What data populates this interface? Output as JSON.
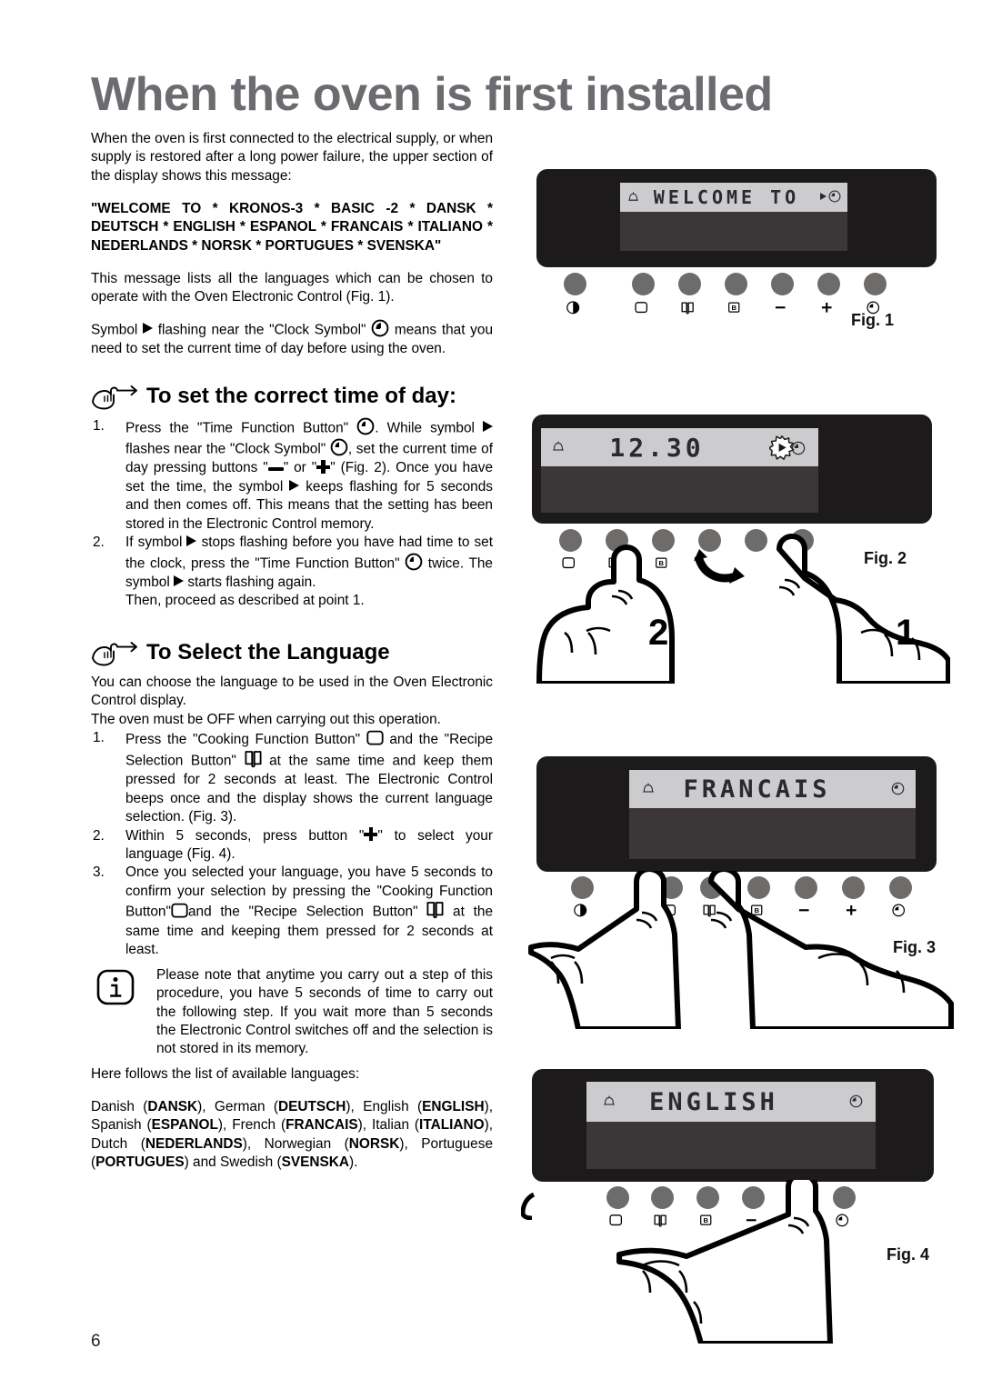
{
  "page": {
    "title": "When the oven is first installed",
    "number": "6"
  },
  "intro": {
    "p1": "When the oven is first connected to the electrical supply, or when supply is restored after a long power failure, the upper section of the display shows this message:",
    "welcome_message": "\"WELCOME TO * KRONOS-3 * BASIC -2 * DANSK * DEUTSCH  * ENGLISH * ESPANOL * FRANCAIS * ITALIANO * NEDERLANDS * NORSK * PORTUGUES * SVENSKA\"",
    "p2": "This message lists all the languages which can be chosen to operate with the Oven Electronic Control (Fig. 1).",
    "p3_a": "Symbol",
    "p3_b": "flashing near the \"Clock Symbol\"",
    "p3_c": "means that you need to set the current time of day before using the oven."
  },
  "section_time": {
    "heading": "To set the correct time of day:",
    "step1": {
      "num": "1.",
      "a": "Press the \"Time Function Button\"",
      "b": ". While symbol",
      "c": "flashes near the \"Clock Symbol\"",
      "d": ", set the current time of day pressing buttons \"",
      "e": "\" or \"",
      "f": "\" (Fig. 2). Once you have set the time, the symbol",
      "g": "keeps flashing for 5 seconds and then comes off. This means that the setting has been stored in the Electronic Control memory."
    },
    "step2": {
      "num": "2.",
      "a": "If symbol",
      "b": "stops flashing before you have had time to set the clock, press the \"Time Function Button\"",
      "c": "twice. The symbol",
      "d": "starts flashing again.",
      "e": "Then, proceed as described at point 1."
    }
  },
  "section_language": {
    "heading": "To Select the Language",
    "p1": "You can choose the language to be used in the Oven Electronic Control display.",
    "p2": "The oven must be OFF when carrying out this operation.",
    "step1": {
      "num": "1.",
      "a": "Press the \"Cooking Function Button\"",
      "b": "and the \"Recipe Selection Button\"",
      "c": "at the same time and keep them pressed for 2 seconds at least. The Electronic Control beeps once and the display shows the current language selection. (Fig. 3)."
    },
    "step2": {
      "num": "2.",
      "a": "Within 5 seconds, press button \"",
      "b": "\" to select your language (Fig. 4)."
    },
    "step3": {
      "num": "3.",
      "a": "Once you selected your language, you have 5 seconds to confirm your selection by pressing the \"Cooking Function Button\"",
      "b": "and the \"Recipe Selection Button\"",
      "c": "at the same time and keeping them pressed for 2 seconds at least."
    },
    "note": "Please note that anytime you carry out a step of this procedure, you have 5 seconds of time to carry out the following step. If you wait more than 5 seconds the Electronic Control switches off and the selection is not stored in its memory.",
    "list_intro": "Here follows the list of available languages:",
    "languages": [
      {
        "name": "Danish",
        "code": "DANSK"
      },
      {
        "name": "German",
        "code": "DEUTSCH"
      },
      {
        "name": "English",
        "code": "ENGLISH"
      },
      {
        "name": "Spanish",
        "code": "ESPANOL"
      },
      {
        "name": "French",
        "code": "FRANCAIS"
      },
      {
        "name": "Italian",
        "code": "ITALIANO"
      },
      {
        "name": "Dutch",
        "code": "NEDERLANDS"
      },
      {
        "name": "Norwegian",
        "code": "NORSK"
      },
      {
        "name": "Portuguese",
        "code": "PORTUGUES"
      },
      {
        "name": "Swedish",
        "code": "SVENSKA"
      }
    ],
    "list_text": "Danish (DANSK), German (DEUTSCH), English (ENGLISH), Spanish (ESPANOL), French (FRANCAIS), Italian (ITALIANO), Dutch (NEDERLANDS), Norwegian (NORSK), Portuguese (PORTUGUES) and Swedish (SVENSKA)."
  },
  "figures": [
    {
      "id": "fig1",
      "label": "Fig. 1",
      "display_text": "WELCOME TO",
      "has_flash_arrow": true,
      "flash_style": "plain",
      "buttons": [
        "power-icon",
        "square-icon",
        "book-icon",
        "b-icon",
        "minus-icon",
        "plus-icon",
        "clock-icon"
      ],
      "fingers": []
    },
    {
      "id": "fig2",
      "label": "Fig. 2",
      "display_text": "12.30",
      "has_flash_arrow": true,
      "flash_style": "starburst",
      "buttons": [
        "square-icon",
        "book-icon",
        "b-icon",
        "minus-icon",
        "plus-icon",
        "clock-icon"
      ],
      "fingers": [
        {
          "label": "2",
          "target": "minus-icon"
        },
        {
          "label": "1",
          "target": "plus-icon"
        }
      ]
    },
    {
      "id": "fig3",
      "label": "Fig. 3",
      "display_text": "FRANCAIS",
      "has_flash_arrow": false,
      "flash_style": "none",
      "buttons": [
        "power-icon",
        "square-icon",
        "book-icon",
        "b-icon",
        "minus-icon",
        "plus-icon",
        "clock-icon"
      ],
      "fingers": [
        {
          "label": "",
          "target": "square-icon"
        },
        {
          "label": "",
          "target": "book-icon"
        }
      ]
    },
    {
      "id": "fig4",
      "label": "Fig. 4",
      "display_text": "ENGLISH",
      "has_flash_arrow": false,
      "flash_style": "none",
      "buttons": [
        "square-icon",
        "book-icon",
        "b-icon",
        "minus-icon",
        "plus-icon",
        "clock-icon"
      ],
      "fingers": [
        {
          "label": "",
          "target": "plus-icon"
        }
      ]
    }
  ],
  "colors": {
    "title": "#6b6b70",
    "panel": "#1c1a1b",
    "lcd": "#ccccce",
    "lcd_lower": "#3b3738",
    "button": "#6e6b6b",
    "text": "#000000"
  }
}
